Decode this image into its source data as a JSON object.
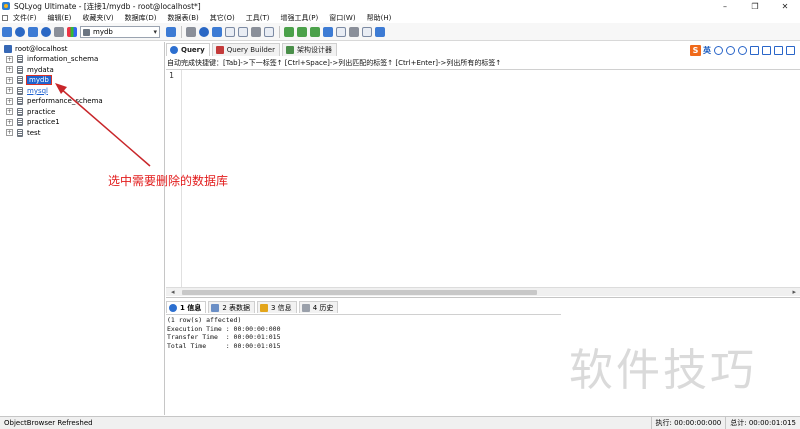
{
  "window": {
    "title": "SQLyog Ultimate - [连接1/mydb - root@localhost*]",
    "controls": [
      "–",
      "❐",
      "✕"
    ]
  },
  "menu": [
    "文件(F)",
    "编辑(E)",
    "收藏夹(V)",
    "数据库(D)",
    "数据表(B)",
    "其它(O)",
    "工具(T)",
    "增强工具(P)",
    "窗口(W)",
    "帮助(H)"
  ],
  "toolbar": {
    "database_select": "mydb"
  },
  "object_browser": {
    "root": "root@localhost",
    "databases": [
      "information_schema",
      "mydata",
      "mydb",
      "mysql",
      "performance_schema",
      "practice",
      "practice1",
      "test"
    ],
    "selected": "mydb"
  },
  "annotation": {
    "text": "选中需要删除的数据库",
    "color": "#e21b1b"
  },
  "editor": {
    "tabs": [
      "Query",
      "Query Builder",
      "架构设计器"
    ],
    "active_tab": "Query",
    "hint": "自动完成快捷键：[Tab]->下一标签↑ [Ctrl+Space]->列出匹配的标签↑ [Ctrl+Enter]->列出所有的标签↑",
    "line_number": "1"
  },
  "ime": {
    "logo": "S",
    "lang": "英"
  },
  "results": {
    "tabs": [
      "1 信息",
      "2 表数据",
      "3 信息",
      "4 历史"
    ],
    "active_tab": "1 信息",
    "messages": [
      "(1 row(s) affected)",
      "Execution Time : 00:00:00:000",
      "Transfer Time  : 00:00:01:015",
      "Total Time     : 00:00:01:015"
    ]
  },
  "watermark": "软件技巧",
  "status": {
    "left": "ObjectBrowser Refreshed",
    "exec": "执行: 00:00:00:000",
    "total": "总计: 00:00:01:015"
  }
}
